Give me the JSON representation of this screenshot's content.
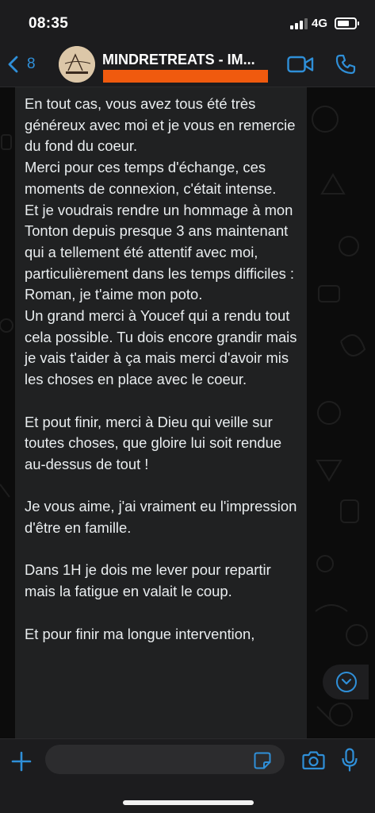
{
  "status_bar": {
    "time": "08:35",
    "network": "4G",
    "icons": [
      "signal-icon",
      "battery-icon"
    ]
  },
  "header": {
    "back_count": "8",
    "title": "MINDRETREATS - IM...",
    "avatar_label": "MINDRETREATS logo",
    "icons": [
      "back-chevron-icon",
      "video-call-icon",
      "phone-call-icon"
    ]
  },
  "message": {
    "text": "En tout cas, vous avez tous été très généreux avec moi et je vous en remercie du fond du coeur.\nMerci pour ces temps d'échange, ces moments de connexion, c'était intense.\nEt je voudrais rendre un hommage à mon Tonton depuis presque 3 ans maintenant qui a tellement été attentif avec moi, particulièrement dans les temps difficiles : Roman, je t'aime mon poto.\nUn grand merci à Youcef qui a rendu tout cela possible. Tu dois encore grandir mais je vais t'aider à ça mais merci d'avoir mis les choses en place avec le coeur.\n\nEt pout finir, merci à Dieu qui veille sur toutes choses, que gloire lui soit rendue au-dessus de tout !\n\nJe vous aime, j'ai vraiment eu l'impression d'être en famille.\n\nDans 1H je dois me lever pour repartir mais la fatigue en valait le coup.\n\nEt pour finir ma longue intervention,"
  },
  "input": {
    "value": "",
    "placeholder": ""
  },
  "colors": {
    "accent": "#2f8fd8",
    "redaction": "#f05a0e",
    "bubble": "#202122",
    "bars": "#1c1c1e"
  }
}
